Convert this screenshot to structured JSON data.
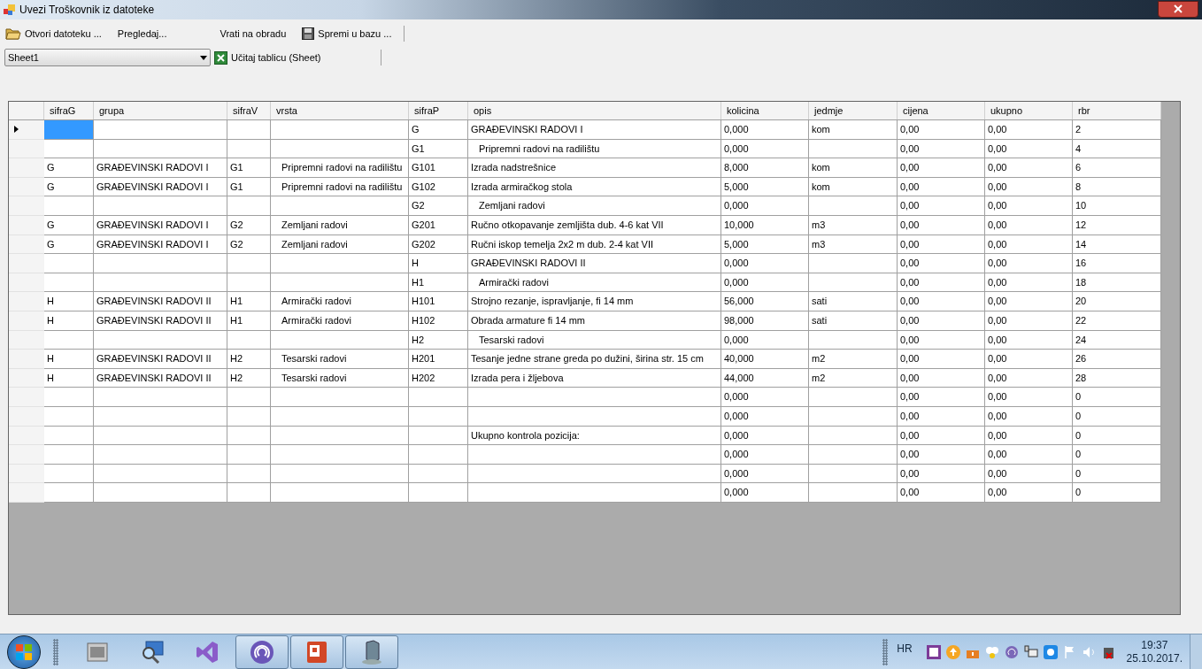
{
  "window": {
    "title": "Uvezi Troškovnik iz datoteke"
  },
  "toolbar": [
    {
      "label": "Otvori datoteku ...",
      "kind": "folder"
    },
    {
      "label": "Pregledaj...",
      "kind": "plain"
    },
    {
      "label": "Vrati na obradu",
      "kind": "plain"
    },
    {
      "label": "Spremi u bazu ...",
      "kind": "save"
    }
  ],
  "sheet_select": {
    "value": "Sheet1"
  },
  "load_button": {
    "label": "Učitaj tablicu (Sheet)"
  },
  "grid": {
    "columns": [
      "sifraG",
      "grupa",
      "sifraV",
      "vrsta",
      "sifraP",
      "opis",
      "kolicina",
      "jedmje",
      "cijena",
      "ukupno",
      "rbr"
    ],
    "rows": [
      {
        "current": true,
        "indented": false,
        "cells": {
          "sifraP": "G",
          "opis": "GRAĐEVINSKI RADOVI I",
          "kolicina": "0,000",
          "jedmje": "kom",
          "cijena": "0,00",
          "ukupno": "0,00",
          "rbr": "2"
        }
      },
      {
        "current": false,
        "indented": true,
        "cells": {
          "sifraP": "G1",
          "opis": "Pripremni radovi na radilištu",
          "kolicina": "0,000",
          "cijena": "0,00",
          "ukupno": "0,00",
          "rbr": "4"
        }
      },
      {
        "current": false,
        "indented": false,
        "cells": {
          "sifraG": "G",
          "grupa": "GRAĐEVINSKI RADOVI I",
          "sifraV": "G1",
          "vrsta": "Pripremni radovi na radilištu",
          "sifraP": "G101",
          "opis": "Izrada nadstrešnice",
          "kolicina": "8,000",
          "jedmje": "kom",
          "cijena": "0,00",
          "ukupno": "0,00",
          "rbr": "6"
        }
      },
      {
        "current": false,
        "indented": false,
        "cells": {
          "sifraG": "G",
          "grupa": "GRAĐEVINSKI RADOVI I",
          "sifraV": "G1",
          "vrsta": "Pripremni radovi na radilištu",
          "sifraP": "G102",
          "opis": "Izrada armiračkog stola",
          "kolicina": "5,000",
          "jedmje": "kom",
          "cijena": "0,00",
          "ukupno": "0,00",
          "rbr": "8"
        }
      },
      {
        "current": false,
        "indented": true,
        "cells": {
          "sifraP": "G2",
          "opis": "Zemljani radovi",
          "kolicina": "0,000",
          "cijena": "0,00",
          "ukupno": "0,00",
          "rbr": "10"
        }
      },
      {
        "current": false,
        "indented": false,
        "cells": {
          "sifraG": "G",
          "grupa": "GRAĐEVINSKI RADOVI I",
          "sifraV": "G2",
          "vrsta": "Zemljani radovi",
          "sifraP": "G201",
          "opis": "Ručno otkopavanje zemljišta dub. 4-6 kat VII",
          "kolicina": "10,000",
          "jedmje": "m3",
          "cijena": "0,00",
          "ukupno": "0,00",
          "rbr": "12"
        }
      },
      {
        "current": false,
        "indented": false,
        "cells": {
          "sifraG": "G",
          "grupa": "GRAĐEVINSKI RADOVI I",
          "sifraV": "G2",
          "vrsta": "Zemljani radovi",
          "sifraP": "G202",
          "opis": "Ručni iskop temelja 2x2 m dub. 2-4 kat VII",
          "kolicina": "5,000",
          "jedmje": "m3",
          "cijena": "0,00",
          "ukupno": "0,00",
          "rbr": "14"
        }
      },
      {
        "current": false,
        "indented": false,
        "cells": {
          "sifraP": "H",
          "opis": "GRAĐEVINSKI RADOVI II",
          "kolicina": "0,000",
          "cijena": "0,00",
          "ukupno": "0,00",
          "rbr": "16"
        }
      },
      {
        "current": false,
        "indented": true,
        "cells": {
          "sifraP": "H1",
          "opis": "Armirački radovi",
          "kolicina": "0,000",
          "cijena": "0,00",
          "ukupno": "0,00",
          "rbr": "18"
        }
      },
      {
        "current": false,
        "indented": false,
        "cells": {
          "sifraG": "H",
          "grupa": "GRAĐEVINSKI RADOVI II",
          "sifraV": "H1",
          "vrsta": "Armirački radovi",
          "sifraP": "H101",
          "opis": "Strojno rezanje, ispravljanje, fi 14 mm",
          "kolicina": "56,000",
          "jedmje": "sati",
          "cijena": "0,00",
          "ukupno": "0,00",
          "rbr": "20"
        }
      },
      {
        "current": false,
        "indented": false,
        "cells": {
          "sifraG": "H",
          "grupa": "GRAĐEVINSKI RADOVI II",
          "sifraV": "H1",
          "vrsta": "Armirački radovi",
          "sifraP": "H102",
          "opis": "Obrada armature fi 14 mm",
          "kolicina": "98,000",
          "jedmje": "sati",
          "cijena": "0,00",
          "ukupno": "0,00",
          "rbr": "22"
        }
      },
      {
        "current": false,
        "indented": true,
        "cells": {
          "sifraP": "H2",
          "opis": "Tesarski radovi",
          "kolicina": "0,000",
          "cijena": "0,00",
          "ukupno": "0,00",
          "rbr": "24"
        }
      },
      {
        "current": false,
        "indented": false,
        "cells": {
          "sifraG": "H",
          "grupa": "GRAĐEVINSKI RADOVI II",
          "sifraV": "H2",
          "vrsta": "Tesarski radovi",
          "sifraP": "H201",
          "opis": "Tesanje jedne strane greda po dužini, širina str. 15 cm",
          "kolicina": "40,000",
          "jedmje": "m2",
          "cijena": "0,00",
          "ukupno": "0,00",
          "rbr": "26"
        }
      },
      {
        "current": false,
        "indented": false,
        "cells": {
          "sifraG": "H",
          "grupa": "GRAĐEVINSKI RADOVI II",
          "sifraV": "H2",
          "vrsta": "Tesarski radovi",
          "sifraP": "H202",
          "opis": "Izrada pera i žljebova",
          "kolicina": "44,000",
          "jedmje": "m2",
          "cijena": "0,00",
          "ukupno": "0,00",
          "rbr": "28"
        }
      },
      {
        "current": false,
        "cells": {
          "kolicina": "0,000",
          "cijena": "0,00",
          "ukupno": "0,00",
          "rbr": "0"
        }
      },
      {
        "current": false,
        "cells": {
          "kolicina": "0,000",
          "cijena": "0,00",
          "ukupno": "0,00",
          "rbr": "0"
        }
      },
      {
        "current": false,
        "indented": false,
        "cells": {
          "opis": "Ukupno kontrola pozicija:",
          "kolicina": "0,000",
          "cijena": "0,00",
          "ukupno": "0,00",
          "rbr": "0"
        }
      },
      {
        "current": false,
        "cells": {
          "kolicina": "0,000",
          "cijena": "0,00",
          "ukupno": "0,00",
          "rbr": "0"
        }
      },
      {
        "current": false,
        "cells": {
          "kolicina": "0,000",
          "cijena": "0,00",
          "ukupno": "0,00",
          "rbr": "0"
        }
      },
      {
        "current": false,
        "cells": {
          "kolicina": "0,000",
          "cijena": "0,00",
          "ukupno": "0,00",
          "rbr": "0"
        }
      }
    ]
  },
  "taskbar": {
    "apps": [
      {
        "kind": "window",
        "active": false
      },
      {
        "kind": "magnifier",
        "active": false
      },
      {
        "kind": "studio",
        "active": false
      },
      {
        "kind": "torrent",
        "active": true
      },
      {
        "kind": "slides",
        "active": true
      },
      {
        "kind": "server",
        "active": true
      }
    ],
    "language": "HR",
    "time": "19:37",
    "date": "25.10.2017."
  }
}
